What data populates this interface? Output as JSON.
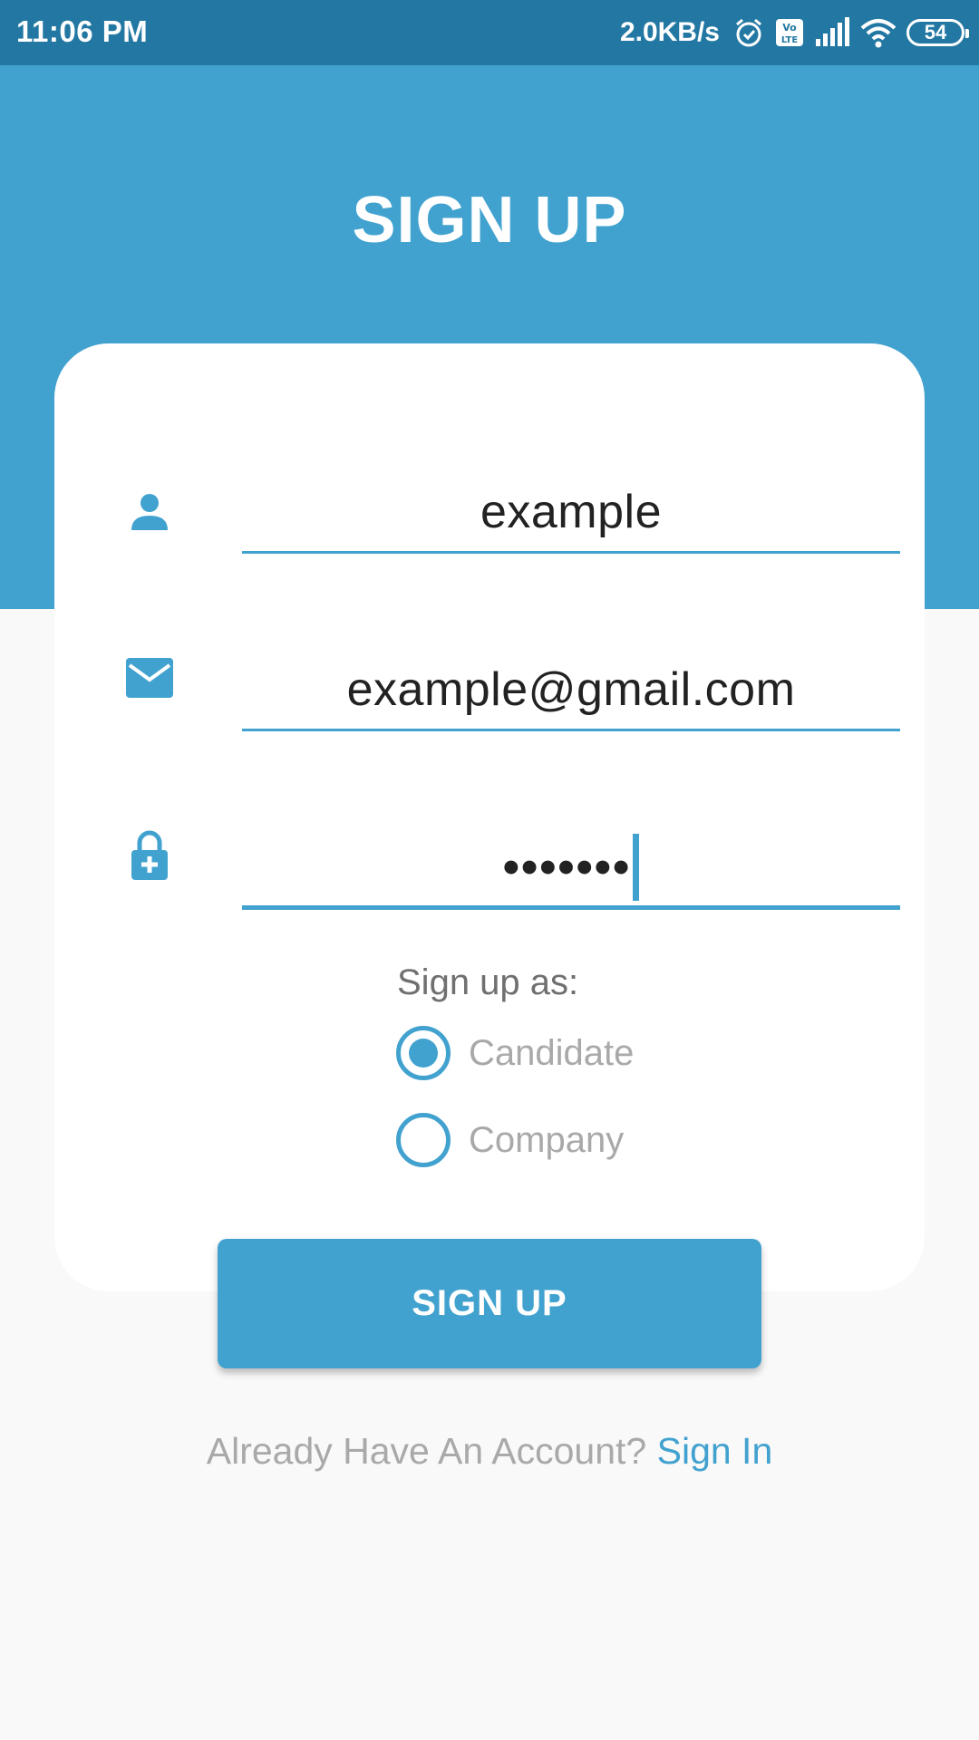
{
  "status_bar": {
    "time": "11:06 PM",
    "net_speed": "2.0KB/s",
    "battery": "54",
    "icons": [
      "alarm-icon",
      "volte-icon",
      "signal-icon",
      "wifi-icon",
      "battery-icon"
    ]
  },
  "header": {
    "title": "SIGN UP"
  },
  "form": {
    "username": {
      "value": "example",
      "icon": "person-icon"
    },
    "email": {
      "value": "example@gmail.com",
      "icon": "mail-icon"
    },
    "password": {
      "masked_value": "•••••••",
      "icon": "lock-icon"
    },
    "signup_as_label": "Sign up as:",
    "roles": [
      {
        "label": "Candidate",
        "selected": true
      },
      {
        "label": "Company",
        "selected": false
      }
    ],
    "submit_label": "SIGN UP"
  },
  "footer": {
    "prompt": "Already Have An Account? ",
    "link": "Sign In"
  },
  "colors": {
    "status_bar": "#2378a3",
    "primary": "#42a2cf",
    "background": "#f9f9f9",
    "card": "#ffffff"
  }
}
